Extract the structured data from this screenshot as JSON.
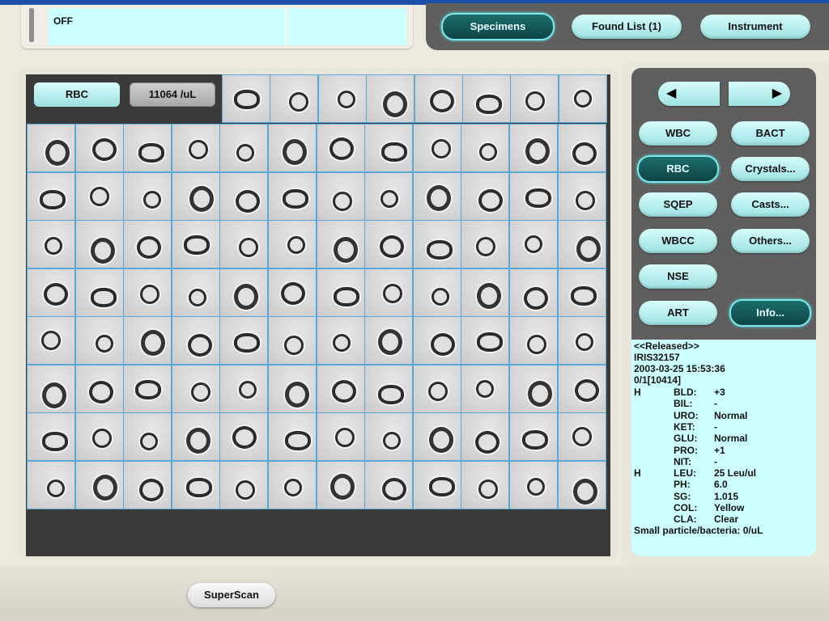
{
  "status": {
    "text": "OFF"
  },
  "nav": {
    "specimens": "Specimens",
    "found_list": "Found List (1)",
    "instrument": "Instrument"
  },
  "main": {
    "category": "RBC",
    "count": "11064 /uL"
  },
  "categories": {
    "wbc": "WBC",
    "bact": "BACT",
    "rbc": "RBC",
    "crystals": "Crystals...",
    "sqep": "SQEP",
    "casts": "Casts...",
    "wbcc": "WBCC",
    "others": "Others...",
    "nse": "NSE",
    "art": "ART",
    "info": "Info..."
  },
  "icons": {
    "prev": "left-arrow-icon",
    "next": "right-arrow-icon"
  },
  "specimen_info": {
    "status": "<<Released>>",
    "id": "IRIS32157",
    "datetime": "2003-03-25 15:53:36",
    "frame": "0/1[10414]",
    "results": [
      {
        "flag": "H",
        "key": "BLD:",
        "value": "+3"
      },
      {
        "flag": "",
        "key": "BIL:",
        "value": "-"
      },
      {
        "flag": "",
        "key": "URO:",
        "value": "Normal"
      },
      {
        "flag": "",
        "key": "KET:",
        "value": "-"
      },
      {
        "flag": "",
        "key": "GLU:",
        "value": "Normal"
      },
      {
        "flag": "",
        "key": "PRO:",
        "value": "+1"
      },
      {
        "flag": "",
        "key": "NIT:",
        "value": "-"
      },
      {
        "flag": "H",
        "key": "LEU:",
        "value": "25 Leu/ul"
      },
      {
        "flag": "",
        "key": "PH:",
        "value": "6.0"
      },
      {
        "flag": "",
        "key": "SG:",
        "value": "1.015"
      },
      {
        "flag": "",
        "key": "COL:",
        "value": "Yellow"
      },
      {
        "flag": "",
        "key": "CLA:",
        "value": "Clear"
      }
    ],
    "footer": "Small particle/bacteria: 0/uL"
  },
  "bottom": {
    "superscan": "SuperScan"
  }
}
